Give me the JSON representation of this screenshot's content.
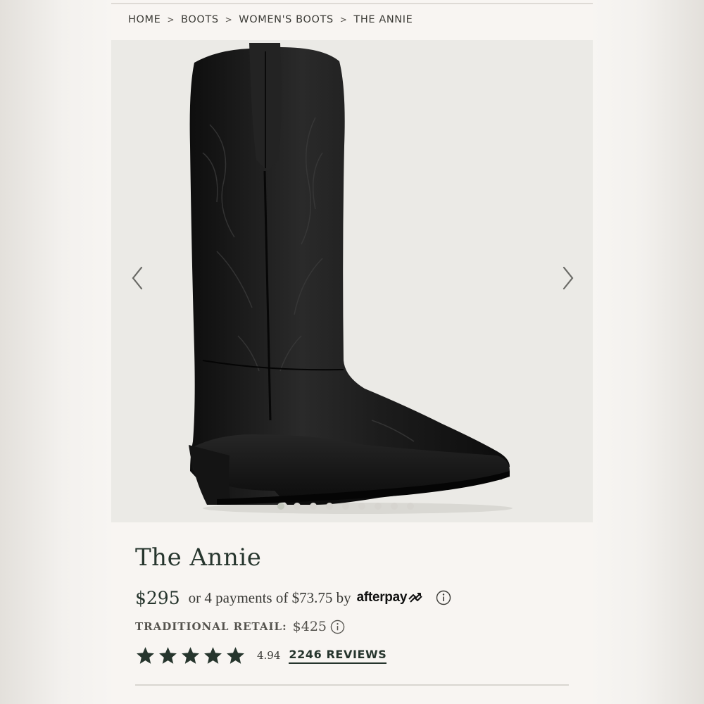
{
  "breadcrumb": {
    "items": [
      "HOME",
      "BOOTS",
      "WOMEN'S BOOTS",
      "THE ANNIE"
    ],
    "separator": ">"
  },
  "gallery": {
    "image": "black-western-boot",
    "prev_icon": "chevron-left-icon",
    "next_icon": "chevron-right-icon",
    "slide_count": 9,
    "active_slide": 1
  },
  "product": {
    "name": "The Annie",
    "price": "$295",
    "installments_text": "or 4 payments of $73.75 by",
    "afterpay_label": "afterpay",
    "retail_label": "TRADITIONAL RETAIL:",
    "retail_price": "$425",
    "rating_value": "4.94",
    "stars": 5,
    "reviews_label": "2246 REVIEWS"
  },
  "colors": {
    "brand_green": "#26352d",
    "card_bg": "#f8f5f2",
    "gallery_bg": "#ebeae6"
  }
}
